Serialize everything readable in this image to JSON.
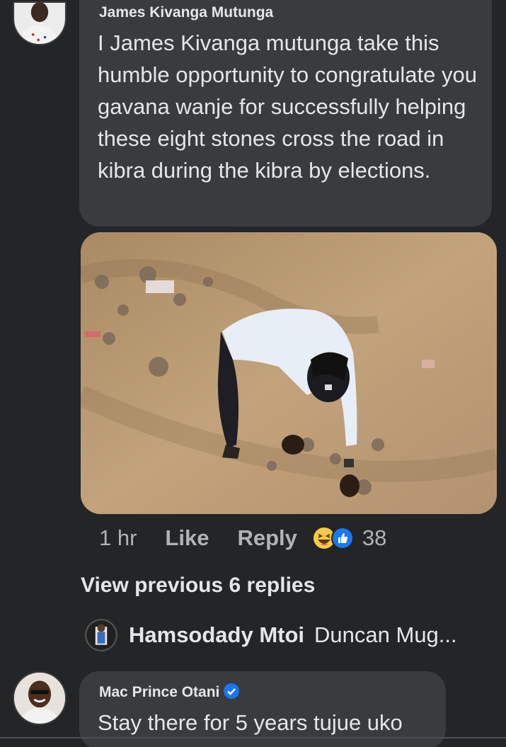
{
  "comment": {
    "author": "James Kivanga Mutunga",
    "text": "I James Kivanga mutunga take this humble opportunity to congratulate you gavana wanje for successfully helping these eight stones cross the road in kibra during the kibra by elections.",
    "time": "1 hr",
    "like_label": "Like",
    "reply_label": "Reply",
    "reaction_icons": [
      "haha-icon",
      "like-icon"
    ],
    "reaction_count": "38"
  },
  "view_previous": "View previous 6 replies",
  "reply_preview": {
    "author": "Hamsodady Mtoi",
    "text": "Duncan Mug..."
  },
  "second_comment": {
    "author": "Mac Prince Otani",
    "verified_icon": "verified-badge-icon",
    "text": "Stay there for 5 years tujue uko"
  },
  "colors": {
    "background": "#242526",
    "bubble": "#3a3b3c",
    "text_primary": "#e4e6eb",
    "text_secondary": "#b0b3b8",
    "verified": "#1877f2"
  }
}
